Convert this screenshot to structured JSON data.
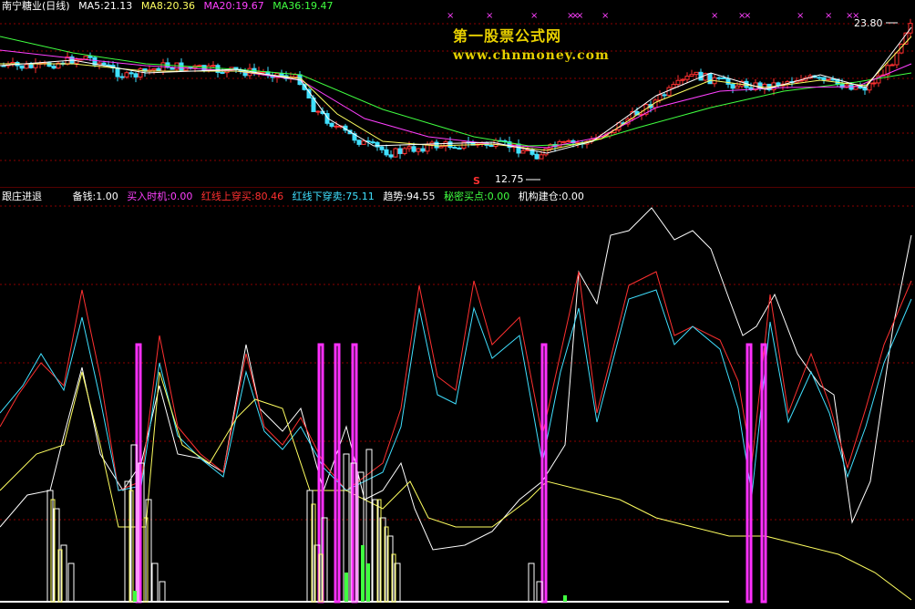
{
  "main_header": {
    "title": "南宁糖业(日线)",
    "ma5": "MA5:21.13",
    "ma8": "MA8:20.36",
    "ma20": "MA20:19.67",
    "ma36": "MA36:19.47"
  },
  "watermark": {
    "cn": "第一股票公式网",
    "url": "www.chnmoney.com"
  },
  "price_labels": {
    "high": "23.80",
    "low": "12.75",
    "signal": "S"
  },
  "indicator_header": {
    "name": "跟庄进退",
    "fields": [
      {
        "text": "备钱:1.00",
        "color": "#ffffff"
      },
      {
        "text": "买入时机:0.00",
        "color": "#ff40ff"
      },
      {
        "text": "红线上穿买:80.46",
        "color": "#ff3030"
      },
      {
        "text": "红线下穿卖:75.11",
        "color": "#40e0ff"
      },
      {
        "text": "趋势:94.55",
        "color": "#ffffff"
      },
      {
        "text": "秘密买点:0.00",
        "color": "#40ff40"
      },
      {
        "text": "机构建仓:0.00",
        "color": "#ffffff"
      }
    ]
  },
  "colors": {
    "ma5": "#ffffff",
    "ma8": "#ffff60",
    "ma20": "#ff40ff",
    "ma36": "#40ff40",
    "grid": "#8b0000",
    "up": "#ff3030",
    "down": "#40e0ff"
  }
}
